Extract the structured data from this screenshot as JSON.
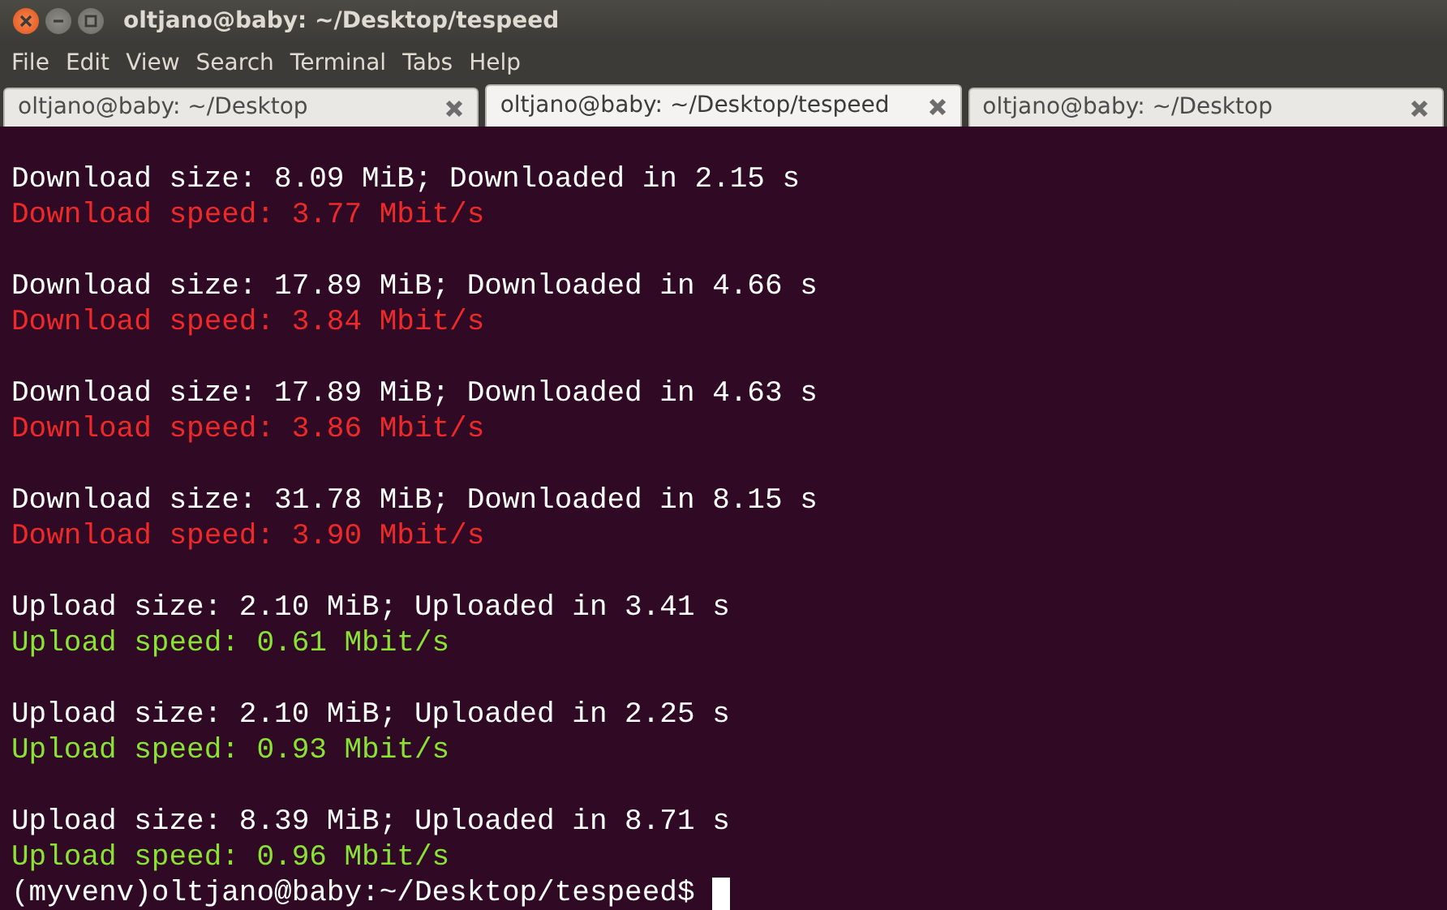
{
  "window": {
    "title": "oltjano@baby: ~/Desktop/tespeed"
  },
  "menu": [
    "File",
    "Edit",
    "View",
    "Search",
    "Terminal",
    "Tabs",
    "Help"
  ],
  "tabs": [
    {
      "label": "oltjano@baby: ~/Desktop",
      "selected": false
    },
    {
      "label": "oltjano@baby: ~/Desktop/tespeed",
      "selected": true
    },
    {
      "label": "oltjano@baby: ~/Desktop",
      "selected": false
    }
  ],
  "terminal": {
    "blocks": [
      {
        "lines": [
          {
            "kind": "info",
            "text": "Download size: 8.09 MiB; Downloaded in 2.15 s"
          },
          {
            "kind": "download_speed",
            "text": "Download speed: 3.77 Mbit/s"
          }
        ]
      },
      {
        "lines": [
          {
            "kind": "info",
            "text": "Download size: 17.89 MiB; Downloaded in 4.66 s"
          },
          {
            "kind": "download_speed",
            "text": "Download speed: 3.84 Mbit/s"
          }
        ]
      },
      {
        "lines": [
          {
            "kind": "info",
            "text": "Download size: 17.89 MiB; Downloaded in 4.63 s"
          },
          {
            "kind": "download_speed",
            "text": "Download speed: 3.86 Mbit/s"
          }
        ]
      },
      {
        "lines": [
          {
            "kind": "info",
            "text": "Download size: 31.78 MiB; Downloaded in 8.15 s"
          },
          {
            "kind": "download_speed",
            "text": "Download speed: 3.90 Mbit/s"
          }
        ]
      },
      {
        "lines": [
          {
            "kind": "info",
            "text": "Upload size: 2.10 MiB; Uploaded in 3.41 s"
          },
          {
            "kind": "upload_speed",
            "text": "Upload speed: 0.61 Mbit/s"
          }
        ]
      },
      {
        "lines": [
          {
            "kind": "info",
            "text": "Upload size: 2.10 MiB; Uploaded in 2.25 s"
          },
          {
            "kind": "upload_speed",
            "text": "Upload speed: 0.93 Mbit/s"
          }
        ]
      },
      {
        "lines": [
          {
            "kind": "info",
            "text": "Upload size: 8.39 MiB; Uploaded in 8.71 s"
          },
          {
            "kind": "upload_speed",
            "text": "Upload speed: 0.96 Mbit/s"
          }
        ]
      }
    ],
    "prompt": "(myvenv)oltjano@baby:~/Desktop/tespeed$"
  }
}
